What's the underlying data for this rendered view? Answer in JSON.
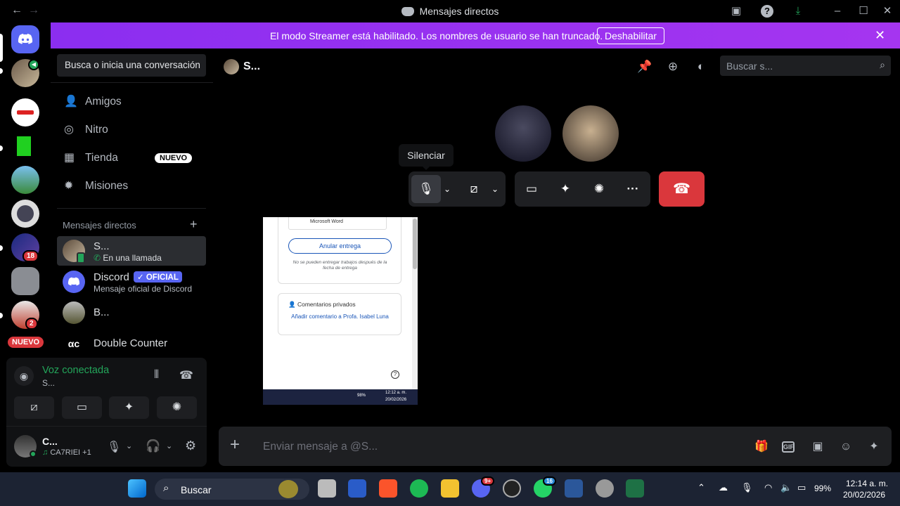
{
  "window": {
    "title": "Mensajes directos"
  },
  "banner": {
    "text": "El modo Streamer está habilitado. Los nombres de usuario se han truncado.",
    "button": "Deshabilitar"
  },
  "guilds": {
    "new_label": "NUEVO",
    "badges": [
      "18",
      "2"
    ]
  },
  "dm_sidebar": {
    "search_placeholder": "Busca o inicia una conversación",
    "nav": [
      {
        "label": "Amigos",
        "icon": "friends-icon"
      },
      {
        "label": "Nitro",
        "icon": "nitro-icon"
      },
      {
        "label": "Tienda",
        "icon": "shop-icon",
        "badge": "NUEVO"
      },
      {
        "label": "Misiones",
        "icon": "quests-icon"
      }
    ],
    "section_title": "Mensajes directos",
    "dms": [
      {
        "name": "S...",
        "sub": "En una llamada"
      },
      {
        "name": "Discord",
        "tag": "OFICIAL",
        "sub": "Mensaje oficial de Discord"
      },
      {
        "name": "B...",
        "sub": ""
      },
      {
        "name": "Double Counter",
        "sub": ""
      }
    ]
  },
  "voice_panel": {
    "status": "Voz conectada",
    "channel": "S...",
    "user": "C...",
    "activity": "CA7RIEI +1"
  },
  "header": {
    "title": "S...",
    "search_placeholder": "Buscar s..."
  },
  "call": {
    "tooltip": "Silenciar"
  },
  "stream_preview": {
    "doc_label": "Microsoft Word",
    "unsubmit_btn": "Anular entrega",
    "note": "No se pueden entregar trabajos después de la fecha de entrega",
    "private_comments": "Comentarios privados",
    "add_comment": "Añadir comentario a Profa. Isabel Luna",
    "tb_time": "12:12 a. m.",
    "tb_date": "20/02/2026",
    "tb_battery": "98%"
  },
  "composer": {
    "placeholder": "Enviar mensaje a @S..."
  },
  "taskbar": {
    "search": "Buscar",
    "time": "12:14 a. m.",
    "date": "20/02/2026",
    "battery": "99%",
    "discord_badge": "9+",
    "whatsapp_badge": "16"
  },
  "colors": {
    "accent": "#5865f2",
    "banner": "#a434f1",
    "green": "#23a55a",
    "hangup": "#da373c"
  }
}
